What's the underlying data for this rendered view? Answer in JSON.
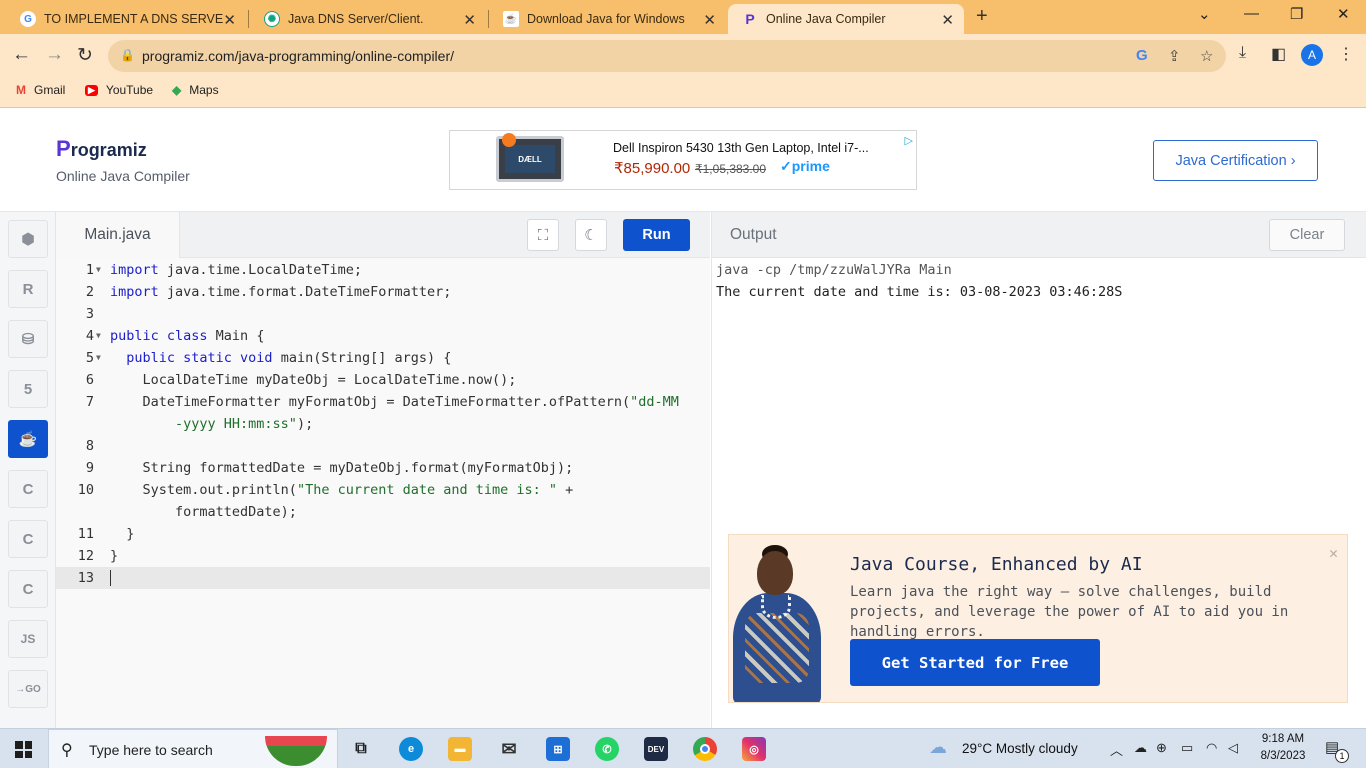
{
  "browser": {
    "tabs": [
      {
        "title": "TO IMPLEMENT A DNS SERVER A",
        "favicon": "google-g-icon",
        "active": false
      },
      {
        "title": "Java DNS Server/Client.",
        "favicon": "chatgpt-icon",
        "active": false
      },
      {
        "title": "Download Java for Windows",
        "favicon": "java-icon",
        "active": false
      },
      {
        "title": "Online Java Compiler",
        "favicon": "programiz-icon",
        "active": true
      }
    ],
    "url": "programiz.com/java-programming/online-compiler/",
    "profile_initial": "A",
    "bookmarks": [
      {
        "label": "Gmail",
        "icon": "gmail-icon"
      },
      {
        "label": "YouTube",
        "icon": "youtube-icon"
      },
      {
        "label": "Maps",
        "icon": "maps-icon"
      }
    ],
    "chrome_color": "#f7be6b"
  },
  "site": {
    "logo_text": "rogramiz",
    "logo_initial": "P",
    "subtitle": "Online Java Compiler",
    "cert_button": "Java Certification ›",
    "ad": {
      "brand": "DÆLL",
      "product": "Dell Inspiron 5430 13th Gen Laptop, Intel i7-...",
      "price": "₹85,990.00",
      "old_price": "₹1,05,383.00",
      "prime": "✓prime"
    }
  },
  "rail": {
    "items": [
      {
        "name": "python",
        "glyph": "🐍",
        "active": false
      },
      {
        "name": "r",
        "glyph": "R",
        "active": false
      },
      {
        "name": "sql",
        "glyph": "⛁",
        "active": false
      },
      {
        "name": "html",
        "glyph": "5",
        "active": false
      },
      {
        "name": "java",
        "glyph": "☕",
        "active": true
      },
      {
        "name": "c",
        "glyph": "C",
        "active": false
      },
      {
        "name": "csharp",
        "glyph": "C",
        "active": false
      },
      {
        "name": "cpp",
        "glyph": "C",
        "active": false
      },
      {
        "name": "js",
        "glyph": "JS",
        "active": false
      },
      {
        "name": "go",
        "glyph": "→GO",
        "active": false
      }
    ],
    "accent": "#0f52ce"
  },
  "editor": {
    "file_tab": "Main.java",
    "run_label": "Run",
    "active_line": 13,
    "lines": [
      {
        "no": "1",
        "fold": true,
        "parts": [
          [
            "kw",
            "import"
          ],
          [
            "t",
            " java.time.LocalDateTime;"
          ]
        ]
      },
      {
        "no": "2",
        "fold": false,
        "parts": [
          [
            "kw",
            "import"
          ],
          [
            "t",
            " java.time.format.DateTimeFormatter;"
          ]
        ]
      },
      {
        "no": "3",
        "fold": false,
        "parts": []
      },
      {
        "no": "4",
        "fold": true,
        "parts": [
          [
            "kw",
            "public class"
          ],
          [
            "t",
            " Main {"
          ]
        ]
      },
      {
        "no": "5",
        "fold": true,
        "parts": [
          [
            "t",
            "  "
          ],
          [
            "kw",
            "public static void"
          ],
          [
            "t",
            " main(String[] args) {"
          ]
        ]
      },
      {
        "no": "6",
        "fold": false,
        "parts": [
          [
            "t",
            "    LocalDateTime myDateObj = LocalDateTime.now();"
          ]
        ]
      },
      {
        "no": "7",
        "fold": false,
        "parts": [
          [
            "t",
            "    DateTimeFormatter myFormatObj = DateTimeFormatter.ofPattern("
          ],
          [
            "str",
            "\"dd-MM"
          ]
        ]
      },
      {
        "no": "",
        "fold": false,
        "parts": [
          [
            "str",
            "        -yyyy HH:mm:ss\""
          ],
          [
            "t",
            ");"
          ]
        ]
      },
      {
        "no": "8",
        "fold": false,
        "parts": []
      },
      {
        "no": "9",
        "fold": false,
        "parts": [
          [
            "t",
            "    String formattedDate = myDateObj.format(myFormatObj);"
          ]
        ]
      },
      {
        "no": "10",
        "fold": false,
        "parts": [
          [
            "t",
            "    System.out.println("
          ],
          [
            "str",
            "\"The current date and time is: \""
          ],
          [
            "t",
            " +"
          ]
        ]
      },
      {
        "no": "",
        "fold": false,
        "parts": [
          [
            "t",
            "        formattedDate);"
          ]
        ]
      },
      {
        "no": "11",
        "fold": false,
        "parts": [
          [
            "t",
            "  }"
          ]
        ]
      },
      {
        "no": "12",
        "fold": false,
        "parts": [
          [
            "t",
            "}"
          ]
        ]
      },
      {
        "no": "13",
        "fold": false,
        "parts": []
      }
    ]
  },
  "output": {
    "title": "Output",
    "clear_label": "Clear",
    "command": "java -cp /tmp/zzuWalJYRa Main",
    "result": "The current date and time is: 03-08-2023 03:46:28S"
  },
  "promo": {
    "title": "Java Course, Enhanced by AI",
    "description": "Learn java the right way – solve challenges, build projects, and leverage the power of AI to aid you in handling errors.",
    "cta": "Get Started for Free"
  },
  "taskbar": {
    "search_placeholder": "Type here to search",
    "weather": "29°C  Mostly cloudy",
    "time": "9:18 AM",
    "date": "8/3/2023",
    "notifications": "1",
    "apps": [
      "task-view",
      "edge",
      "file-explorer",
      "mail",
      "store",
      "whatsapp",
      "dev-home",
      "chrome",
      "instagram"
    ]
  }
}
